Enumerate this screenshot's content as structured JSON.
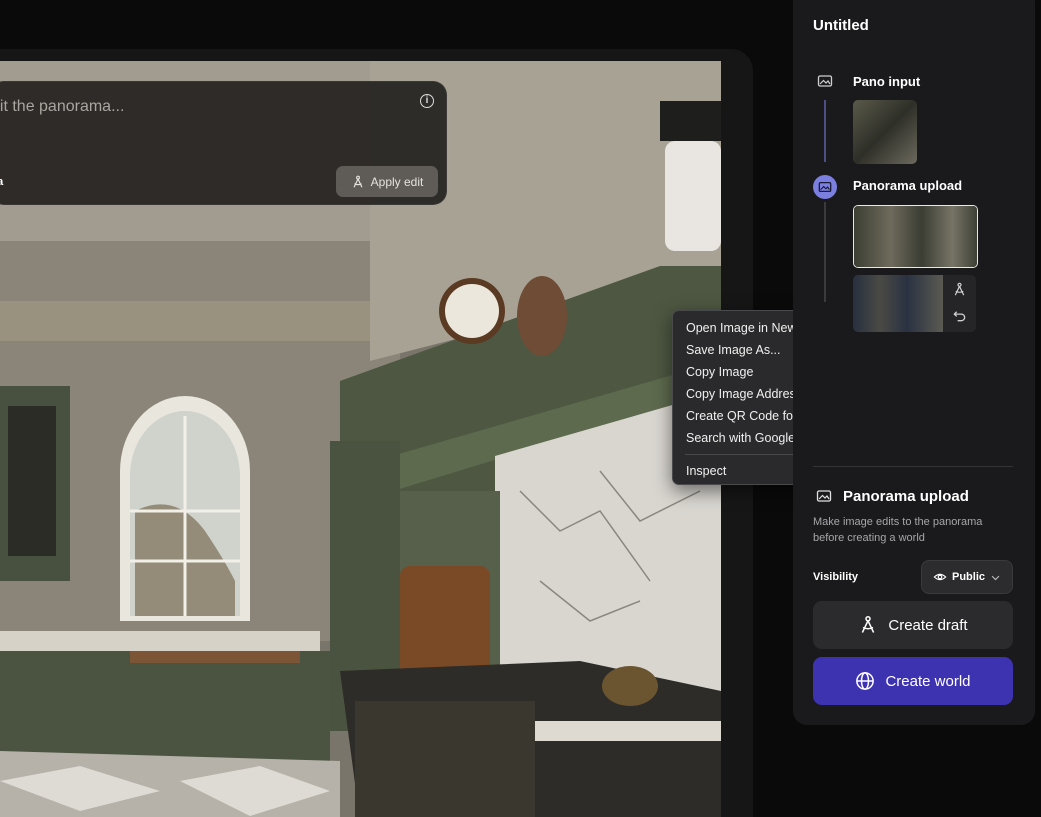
{
  "edit": {
    "placeholder": "dit the panorama...",
    "suffix_text": "ea",
    "apply_label": "Apply edit"
  },
  "context_menu": {
    "items": [
      "Open Image in New Tab",
      "Save Image As...",
      "Copy Image",
      "Copy Image Address",
      "Create QR Code for this Image",
      "Search with Google Lens"
    ],
    "inspect": "Inspect"
  },
  "panel": {
    "title": "Untitled",
    "steps": [
      {
        "label": "Pano input",
        "icon": "image-icon"
      },
      {
        "label": "Panorama upload",
        "icon": "image-icon"
      }
    ],
    "partial_text": "d",
    "section": {
      "title": "Panorama upload",
      "description": "Make image edits to the panorama before creating a world"
    },
    "visibility": {
      "label": "Visibility",
      "value": "Public"
    },
    "create_draft": "Create draft",
    "create_world": "Create world"
  },
  "colors": {
    "accent": "#3d33b0",
    "step_active": "#7b7fe0",
    "panel_bg": "#1a1a1c"
  }
}
